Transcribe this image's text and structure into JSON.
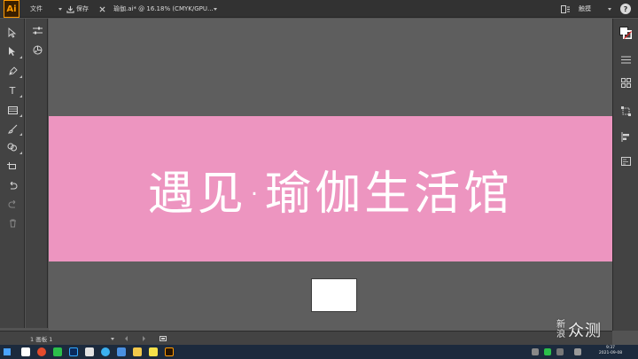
{
  "app": {
    "logo": "Ai",
    "menu_file": "文件",
    "save_label": "保存",
    "doc_tab": "瑜伽.ai* @ 16.18% (CMYK/GPU...",
    "workspace_label": "触摸",
    "help_label": "?"
  },
  "canvas": {
    "banner_text": "遇见·瑜伽生活馆",
    "banner_color": "#ed95c0",
    "background_color": "#5e5e5e"
  },
  "statusbar": {
    "artboard_select": "1 画板 1"
  },
  "taskbar": {
    "time": "9:37",
    "date": "2021-09-08"
  },
  "watermark": {
    "top_char": "新",
    "bottom_char": "浪",
    "main_text": "众测"
  },
  "icons": {
    "left_tools": [
      "selection-icon",
      "direct-selection-icon",
      "pen-icon",
      "type-icon",
      "rectangle-icon",
      "brush-icon",
      "shape-builder-icon",
      "artboard-icon",
      "undo-icon",
      "redo-icon",
      "delete-icon"
    ],
    "right_panels": [
      "fill-stroke-icon",
      "layers-icon",
      "swatches-icon",
      "transform-icon",
      "align-icon",
      "properties-icon"
    ]
  }
}
